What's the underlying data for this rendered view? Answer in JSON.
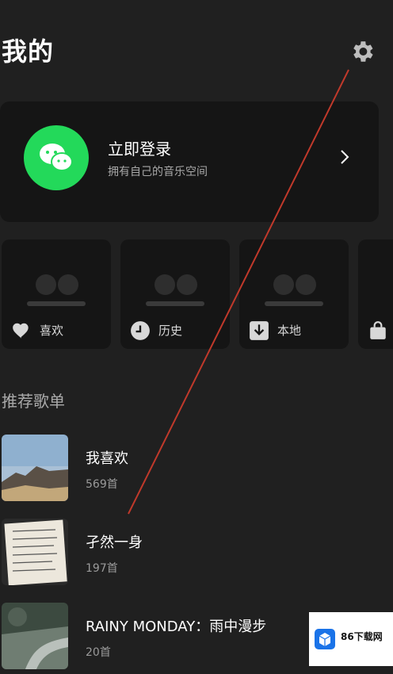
{
  "header": {
    "title": "我的",
    "settings_icon": "gear-icon"
  },
  "login": {
    "title": "立即登录",
    "subtitle": "拥有自己的音乐空间",
    "icon": "wechat-icon",
    "accent": "#23d95a"
  },
  "tiles": [
    {
      "label": "喜欢",
      "icon": "heart-icon"
    },
    {
      "label": "历史",
      "icon": "clock-icon"
    },
    {
      "label": "本地",
      "icon": "download-icon"
    },
    {
      "label": "",
      "icon": "bag-icon"
    }
  ],
  "section": {
    "title": "推荐歌单"
  },
  "playlists": [
    {
      "name": "我喜欢",
      "count": "569首"
    },
    {
      "name": "孑然一身",
      "count": "197首"
    },
    {
      "name": "RAINY MONDAY：雨中漫步",
      "count": "20首"
    }
  ],
  "watermark": {
    "label": "86下载网"
  }
}
